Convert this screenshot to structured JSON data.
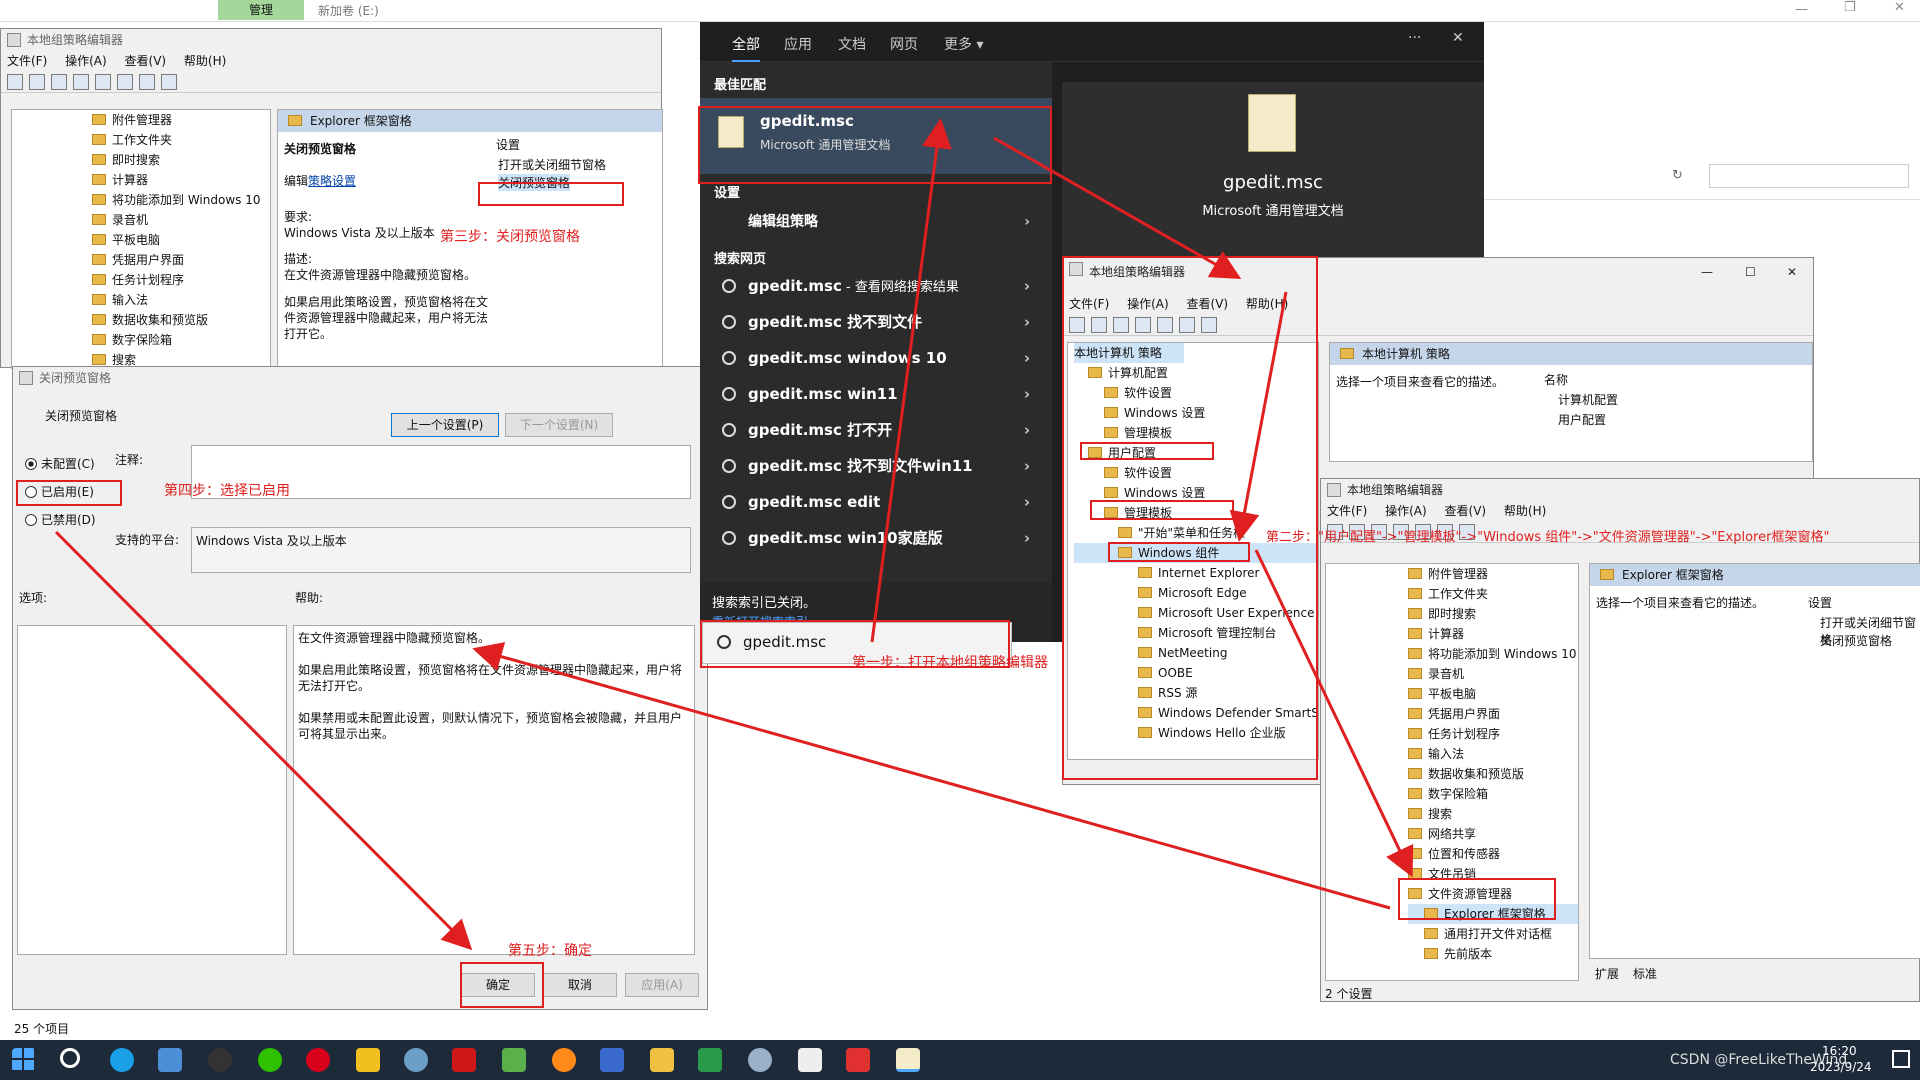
{
  "explorer_bg": {
    "ribbon_tab": "管理",
    "drive_label": "新加卷 (E:)",
    "status": "25 个项目"
  },
  "gpedit_main": {
    "title": "本地组策略编辑器",
    "menu": [
      "文件(F)",
      "操作(A)",
      "查看(V)",
      "帮助(H)"
    ],
    "tree": [
      "附件管理器",
      "工作文件夹",
      "即时搜索",
      "计算器",
      "将功能添加到 Windows 10",
      "录音机",
      "平板电脑",
      "凭据用户界面",
      "任务计划程序",
      "输入法",
      "数据收集和预览版",
      "数字保险箱",
      "搜索"
    ],
    "panel_title": "Explorer 框架窗格",
    "policy_name": "关闭预览窗格",
    "edit_prefix": "编辑",
    "edit_link": "策略设置",
    "req_label": "要求:",
    "req_value": "Windows Vista 及以上版本",
    "desc_label": "描述:",
    "desc_1": "在文件资源管理器中隐藏预览窗格。",
    "desc_2": "如果启用此策略设置，预览窗格将在文件资源管理器中隐藏起来，用户将无法打开它。",
    "settings_header": "设置",
    "settings": [
      "打开或关闭细节窗格",
      "关闭预览窗格"
    ]
  },
  "dialog": {
    "title": "关闭预览窗格",
    "policy": "关闭预览窗格",
    "prev_btn": "上一个设置(P)",
    "next_btn": "下一个设置(N)",
    "opt_unconfigured": "未配置(C)",
    "opt_enabled": "已启用(E)",
    "opt_disabled": "已禁用(D)",
    "comment_label": "注释:",
    "platform_label": "支持的平台:",
    "platform_value": "Windows Vista 及以上版本",
    "options_label": "选项:",
    "help_label": "帮助:",
    "help_1": "在文件资源管理器中隐藏预览窗格。",
    "help_2": "如果启用此策略设置，预览窗格将在文件资源管理器中隐藏起来，用户将无法打开它。",
    "help_3": "如果禁用或未配置此设置，则默认情况下，预览窗格会被隐藏，并且用户可将其显示出来。",
    "ok": "确定",
    "cancel": "取消",
    "apply": "应用(A)"
  },
  "search": {
    "tabs": [
      "全部",
      "应用",
      "文档",
      "网页",
      "更多"
    ],
    "best_match_label": "最佳匹配",
    "best_name": "gpedit.msc",
    "best_type": "Microsoft 通用管理文档",
    "settings_label": "设置",
    "settings_item": "编辑组策略",
    "web_label": "搜索网页",
    "web_items": [
      {
        "main": "gpedit.msc",
        "sub": " - 查看网络搜索结果"
      },
      {
        "main": "gpedit.msc 找不到文件",
        "sub": ""
      },
      {
        "main": "gpedit.msc windows 10",
        "sub": ""
      },
      {
        "main": "gpedit.msc win11",
        "sub": ""
      },
      {
        "main": "gpedit.msc 打不开",
        "sub": ""
      },
      {
        "main": "gpedit.msc 找不到文件win11",
        "sub": ""
      },
      {
        "main": "gpedit.msc edit",
        "sub": ""
      },
      {
        "main": "gpedit.msc win10家庭版",
        "sub": ""
      }
    ],
    "index_off": "搜索索引已关闭。",
    "reindex_link": "重新打开搜索索引。",
    "preview_name": "gpedit.msc",
    "preview_type": "Microsoft 通用管理文档",
    "query": "gpedit.msc"
  },
  "gpedit2": {
    "title": "本地组策略编辑器",
    "menu": [
      "文件(F)",
      "操作(A)",
      "查看(V)",
      "帮助(H)"
    ],
    "root": "本地计算机 策略",
    "tree": [
      "计算机配置",
      "软件设置",
      "Windows 设置",
      "管理模板",
      "用户配置",
      "软件设置",
      "Windows 设置",
      "管理模板",
      "\"开始\"菜单和任务栏",
      "Windows 组件",
      "Internet Explorer",
      "Microsoft Edge",
      "Microsoft User Experience",
      "Microsoft 管理控制台",
      "NetMeeting",
      "OOBE",
      "RSS 源",
      "Windows Defender SmartScreen",
      "Windows Hello 企业版"
    ],
    "panel_title": "本地计算机 策略",
    "hint": "选择一个项目来查看它的描述。",
    "name_header": "名称",
    "items": [
      "计算机配置",
      "用户配置"
    ]
  },
  "gpedit3": {
    "title": "本地组策略编辑器",
    "menu": [
      "文件(F)",
      "操作(A)",
      "查看(V)",
      "帮助(H)"
    ],
    "tree": [
      "附件管理器",
      "工作文件夹",
      "即时搜索",
      "计算器",
      "将功能添加到 Windows 10",
      "录音机",
      "平板电脑",
      "凭据用户界面",
      "任务计划程序",
      "输入法",
      "数据收集和预览版",
      "数字保险箱",
      "搜索",
      "网络共享",
      "位置和传感器",
      "文件吊销",
      "文件资源管理器",
      "Explorer 框架窗格",
      "通用打开文件对话框",
      "先前版本"
    ],
    "panel_title": "Explorer 框架窗格",
    "hint": "选择一个项目来查看它的描述。",
    "settings_header": "设置",
    "settings": [
      "打开或关闭细节窗格",
      "关闭预览窗格"
    ],
    "tab_ext": "扩展",
    "tab_std": "标准",
    "status": "2 个设置"
  },
  "annotations": {
    "step1": "第一步：打开本地组策略编辑器",
    "step2": "第二步：\"用户配置\"->\"管理模板\"->\"Windows 组件\"->\"文件资源管理器\"->\"Explorer框架窗格\"",
    "step3": "第三步：关闭预览窗格",
    "step4": "第四步：选择已启用",
    "step5": "第五步：确定"
  },
  "taskbar": {
    "time": "16:20",
    "date": "2023/9/24",
    "watermark": "CSDN @FreeLikeTheWind."
  },
  "colors": {
    "annotation": "#e02020",
    "search_bg": "#1f1f1f",
    "accent": "#0078d4"
  }
}
